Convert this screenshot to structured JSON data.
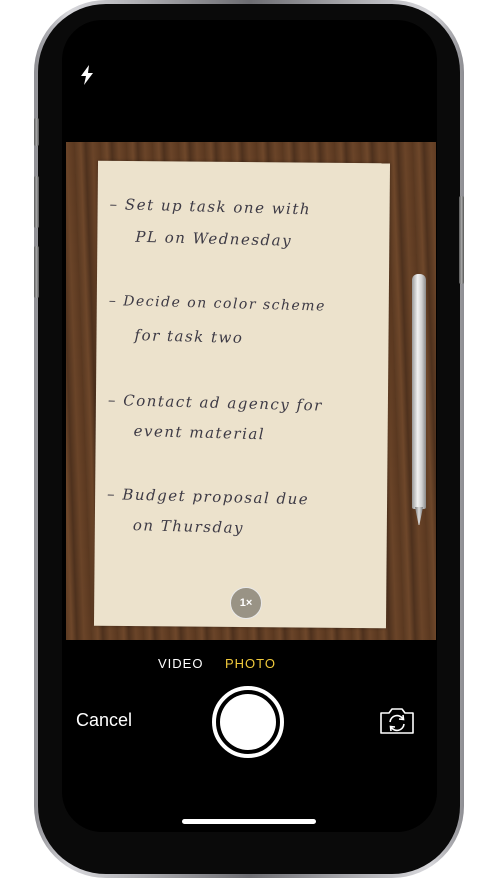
{
  "camera": {
    "zoom_label": "1×",
    "modes": {
      "video": "VIDEO",
      "photo": "PHOTO"
    },
    "selected_mode": "PHOTO",
    "cancel_label": "Cancel",
    "colors": {
      "selected_mode": "#f0c93c",
      "background": "#000000"
    }
  },
  "icons": {
    "flash": "flash-icon",
    "flip": "flip-camera-icon",
    "shutter": "shutter-button"
  },
  "note": {
    "lines": [
      "– Set up task one with",
      "PL on Wednesday",
      "– Decide on color scheme",
      "for task two",
      "– Contact ad agency for",
      "event material",
      "– Budget proposal due",
      "on Thursday"
    ]
  }
}
